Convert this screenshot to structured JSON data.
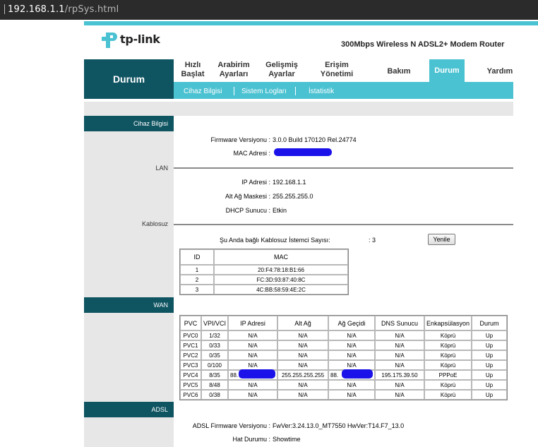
{
  "browser": {
    "url_host": "192.168.1.1",
    "url_path": "/rpSys.html"
  },
  "header": {
    "logo_text": "tp-link",
    "model": "300Mbps Wireless N ADSL2+ Modem Router",
    "brand_color": "#4bc2d2",
    "dark_color": "#0f5461"
  },
  "nav": {
    "current_section": "Durum",
    "items": [
      {
        "label1": "Hızlı",
        "label2": "Başlat"
      },
      {
        "label1": "Arabirim",
        "label2": "Ayarları"
      },
      {
        "label1": "Gelişmiş",
        "label2": "Ayarlar"
      },
      {
        "label1": "Erişim",
        "label2": "Yönetimi"
      },
      {
        "label1": "Bakım",
        "label2": ""
      },
      {
        "label1": "Durum",
        "label2": ""
      },
      {
        "label1": "Yardım",
        "label2": ""
      }
    ],
    "active_item": "Durum",
    "subitems": [
      "Cihaz Bilgisi",
      "Sistem Logları",
      "İstatistik"
    ]
  },
  "device": {
    "section_title": "Cihaz Bilgisi",
    "firmware_label": "Firmware Versiyonu :",
    "firmware_value": "3.0.0 Build 170120 Rel.24774",
    "mac_label": "MAC Adresi :",
    "mac_value": "(redacted)"
  },
  "lan": {
    "title": "LAN",
    "ip_label": "IP Adresi :",
    "ip_value": "192.168.1.1",
    "mask_label": "Alt Ağ Maskesi :",
    "mask_value": "255.255.255.0",
    "dhcp_label": "DHCP Sunucu :",
    "dhcp_value": "Etkin"
  },
  "wireless": {
    "title": "Kablosuz",
    "clients_label": "Şu Anda bağlı Kablosuz İstemci Sayısı:",
    "clients_value": ": 3",
    "refresh_label": "Yenile",
    "headers": [
      "ID",
      "MAC"
    ],
    "rows": [
      [
        "1",
        "20:F4:78:18:B1:66"
      ],
      [
        "2",
        "FC:3D:93:87:40:8C"
      ],
      [
        "3",
        "4C:BB:58:59:4E:2C"
      ]
    ]
  },
  "wan": {
    "title": "WAN",
    "headers": [
      "PVC",
      "VPI/VCI",
      "IP Adresi",
      "Alt Ağ",
      "Ağ Geçidi",
      "DNS Sunucu",
      "Enkapsülasyon",
      "Durum"
    ],
    "rows": [
      [
        "PVC0",
        "1/32",
        "N/A",
        "N/A",
        "N/A",
        "N/A",
        "Köprü",
        "Up"
      ],
      [
        "PVC1",
        "0/33",
        "N/A",
        "N/A",
        "N/A",
        "N/A",
        "Köprü",
        "Up"
      ],
      [
        "PVC2",
        "0/35",
        "N/A",
        "N/A",
        "N/A",
        "N/A",
        "Köprü",
        "Up"
      ],
      [
        "PVC3",
        "0/100",
        "N/A",
        "N/A",
        "N/A",
        "N/A",
        "Köprü",
        "Up"
      ],
      [
        "PVC4",
        "8/35",
        "88.",
        "255.255.255.255",
        "88.",
        "195.175.39.50",
        "PPPoE",
        "Up"
      ],
      [
        "PVC5",
        "8/48",
        "N/A",
        "N/A",
        "N/A",
        "N/A",
        "Köprü",
        "Up"
      ],
      [
        "PVC6",
        "0/38",
        "N/A",
        "N/A",
        "N/A",
        "N/A",
        "Köprü",
        "Up"
      ]
    ]
  },
  "adsl": {
    "title": "ADSL",
    "fw_label": "ADSL Firmware Versiyonu :",
    "fw_value": "FwVer:3.24.13.0_MT7550 HwVer:T14.F7_13.0",
    "line_label": "Hat Durumu :",
    "line_value": "Showtime"
  }
}
